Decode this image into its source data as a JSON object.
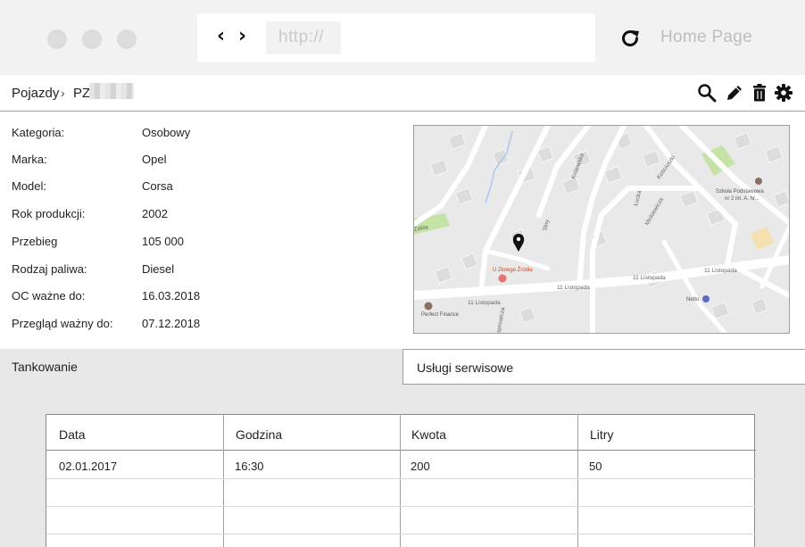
{
  "browser": {
    "url_placeholder": "http://",
    "back_label": "‹",
    "forward_label": "›",
    "home_label": "Home Page"
  },
  "breadcrumb": {
    "root": "Pojazdy",
    "separator": "›",
    "current": "PZ"
  },
  "toolbar": {
    "icons": [
      "search-icon",
      "pencil-icon",
      "trash-icon",
      "gear-icon"
    ]
  },
  "details": [
    {
      "label": "Kategoria:",
      "value": "Osobowy"
    },
    {
      "label": "Marka:",
      "value": "Opel"
    },
    {
      "label": "Model:",
      "value": "Corsa"
    },
    {
      "label": "Rok produkcji:",
      "value": "2002"
    },
    {
      "label": "Przebieg",
      "value": "105 000"
    },
    {
      "label": "Rodzaj paliwa:",
      "value": "Diesel"
    },
    {
      "label": "OC ważne do:",
      "value": "16.03.2018"
    },
    {
      "label": "Przegląd ważny do:",
      "value": "07.12.2018"
    }
  ],
  "map": {
    "labels": {
      "school": "Szkoła Podstawowa",
      "school2": "nr 2 im. A. hr...",
      "restaurant": "U Złotego Źródła",
      "finance": "Perfect Finance",
      "netto": "Netto",
      "street1": "11 Listopada",
      "street2": "11 Listopada",
      "street3": "11 Listopada",
      "street4": "11 Listopada",
      "s_krolewska": "Królewska",
      "s_lucka": "Łucka",
      "s_skoczylas": "Skry",
      "s_zabia": "Zabia",
      "s_mickiewicza": "Mickiewicza",
      "s_kasprowicza": "Kasprowicza",
      "s_kosciuszki": "Kościuszki"
    }
  },
  "tabs": [
    {
      "label": "Tankowanie",
      "active": true
    },
    {
      "label": "Usługi serwisowe",
      "active": false
    }
  ],
  "table": {
    "headers": [
      "Data",
      "Godzina",
      "Kwota",
      "Litry"
    ],
    "rows": [
      [
        "02.01.2017",
        "16:30",
        "200",
        "50"
      ]
    ]
  },
  "colors": {
    "chrome_bg": "#f2f2f2",
    "map_bg": "#e8e8e8",
    "marker": "#111111"
  }
}
